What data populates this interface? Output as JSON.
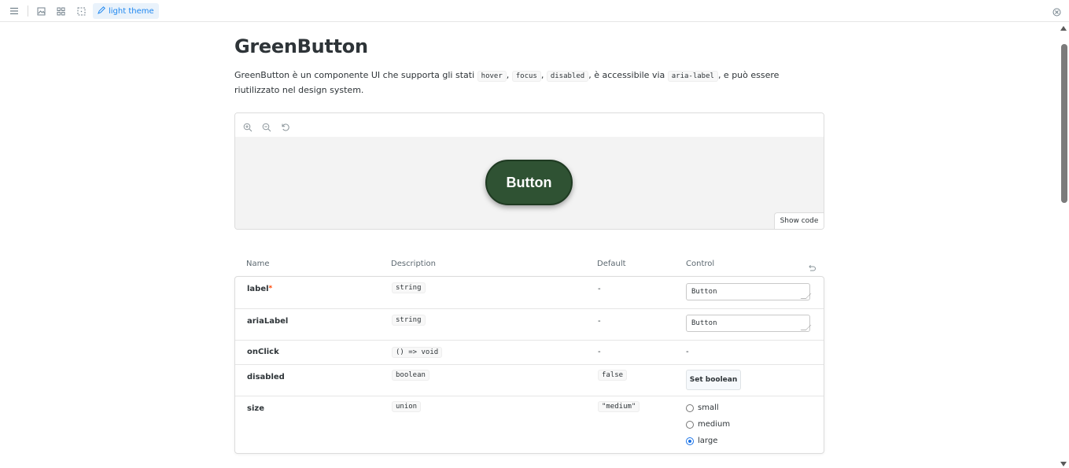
{
  "toolbar": {
    "theme_label": "light theme",
    "icons": [
      "menu-icon",
      "image-icon",
      "grid-icon",
      "frame-icon",
      "brush-icon",
      "close-icon"
    ]
  },
  "page": {
    "title": "GreenButton",
    "desc_prefix": "GreenButton è un componente UI che supporta gli stati",
    "state_hover": "hover",
    "state_focus": "focus",
    "state_disabled": "disabled",
    "desc_mid": ", è accessibile via",
    "aria": "aria-label",
    "desc_suffix": ", e può essere riutilizzato nel design system."
  },
  "preview": {
    "button_label": "Button",
    "show_code": "Show code",
    "button_color": "#2f5233"
  },
  "table": {
    "headers": {
      "name": "Name",
      "description": "Description",
      "default": "Default",
      "control": "Control"
    },
    "rows": [
      {
        "name": "label",
        "required": "*",
        "type": "string",
        "default": "-",
        "control_value": "Button"
      },
      {
        "name": "ariaLabel",
        "type": "string",
        "default": "-",
        "control_value": "Button"
      },
      {
        "name": "onClick",
        "type": "() => void",
        "default": "-",
        "control_value": "-"
      },
      {
        "name": "disabled",
        "type": "boolean",
        "default": "false",
        "control_label": "Set boolean"
      },
      {
        "name": "size",
        "type": "union",
        "default": "\"medium\"",
        "options": [
          "small",
          "medium",
          "large"
        ],
        "selected": "large"
      }
    ]
  }
}
